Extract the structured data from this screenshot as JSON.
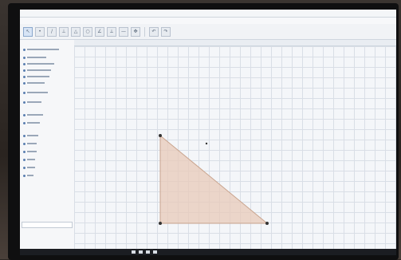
{
  "window": {
    "title": "",
    "menus": [
      "",
      "",
      "",
      "",
      ""
    ]
  },
  "toolbar": {
    "tools": [
      "pointer-icon",
      "point-icon",
      "line-icon",
      "perpendicular-icon",
      "polygon-icon",
      "circle-icon",
      "angle-icon",
      "reflect-icon",
      "slider-icon",
      "move-view-icon"
    ]
  },
  "graphics": {
    "shape": "triangle",
    "fill_color": "#e8c9b8",
    "stroke_color": "#c9a48e",
    "point_color": "#333333"
  },
  "colors": {
    "accent": "#5a7fb0",
    "grid": "#d9dee6"
  }
}
